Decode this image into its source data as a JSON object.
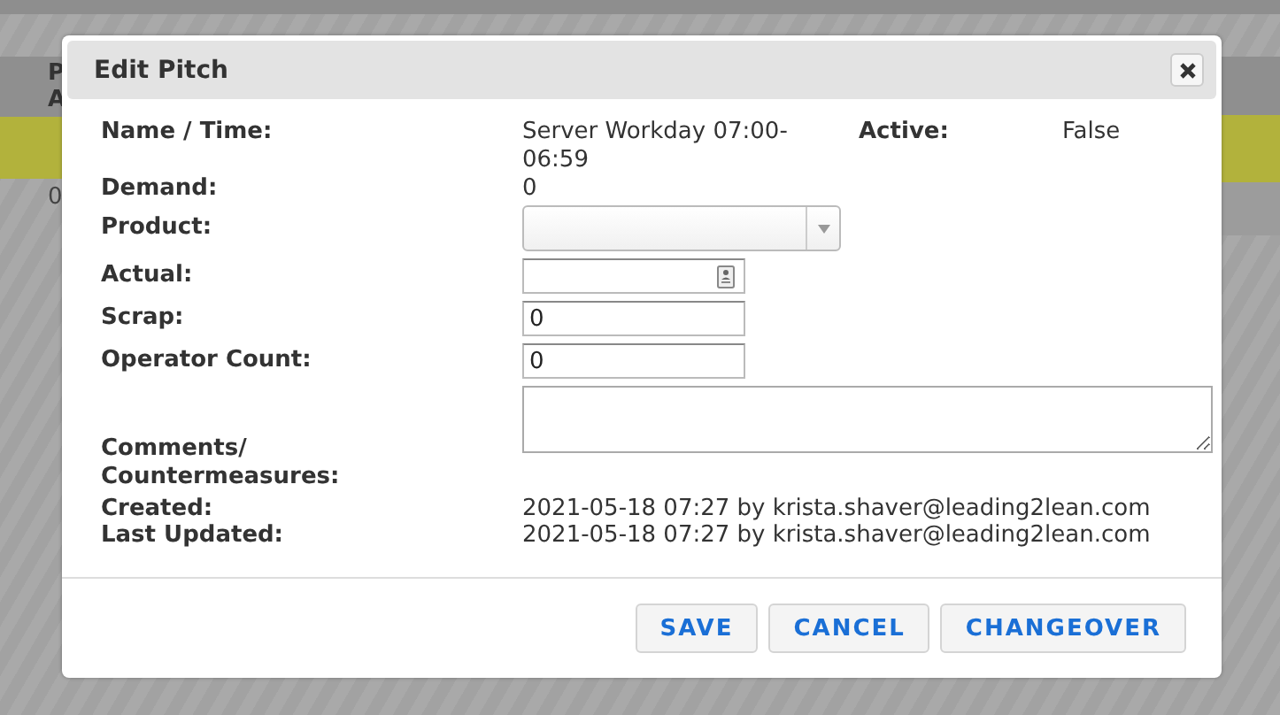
{
  "background_table": {
    "header_lines": [
      "P",
      "A"
    ],
    "cell": "0"
  },
  "dialog": {
    "title": "Edit Pitch",
    "name_time": {
      "label": "Name / Time:",
      "value": "Server Workday 07:00-06:59"
    },
    "active": {
      "label": "Active:",
      "value": "False"
    },
    "demand": {
      "label": "Demand:",
      "value": "0"
    },
    "product": {
      "label": "Product:"
    },
    "actual": {
      "label": "Actual:"
    },
    "scrap": {
      "label": "Scrap:",
      "value": "0"
    },
    "operator_count": {
      "label": "Operator Count:",
      "value": "0"
    },
    "comments": {
      "label_lines": [
        "Comments/",
        "Countermeasures:"
      ]
    },
    "created": {
      "label": "Created:",
      "value": "2021-05-18 07:27 by krista.shaver@leading2lean.com"
    },
    "last_updated": {
      "label": "Last Updated:",
      "value": "2021-05-18 07:27 by krista.shaver@leading2lean.com"
    },
    "buttons": [
      "SAVE",
      "CANCEL",
      "CHANGEOVER"
    ]
  }
}
